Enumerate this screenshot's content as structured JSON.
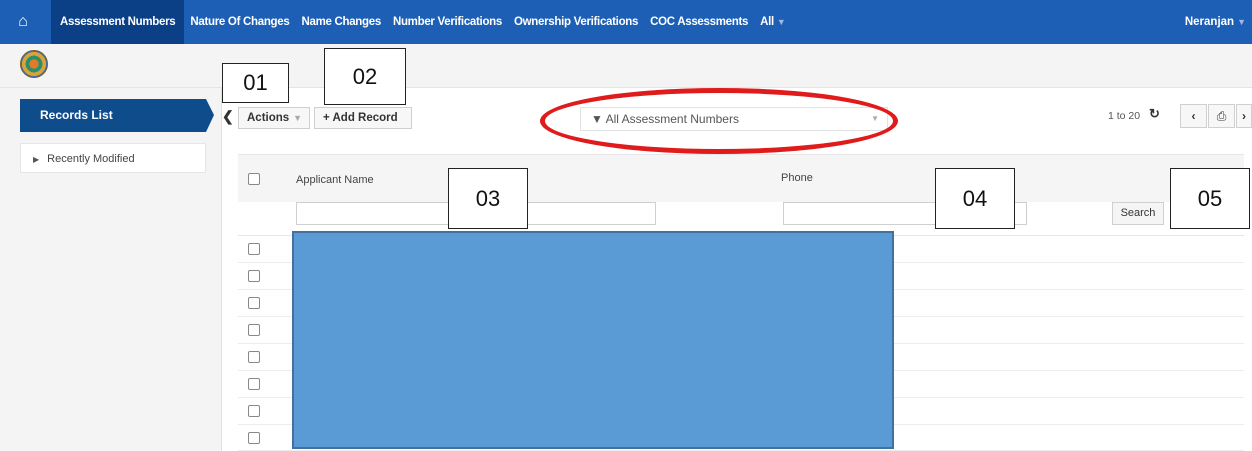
{
  "navbar": {
    "home_icon": "home-icon",
    "items": [
      {
        "label": "Assessment Numbers",
        "active": true
      },
      {
        "label": "Nature Of Changes"
      },
      {
        "label": "Name Changes"
      },
      {
        "label": "Number Verifications"
      },
      {
        "label": "Ownership Verifications"
      },
      {
        "label": "COC Assessments"
      },
      {
        "label": "All",
        "dropdown": true
      }
    ],
    "user": "Neranjan",
    "color": "#1d5fb4"
  },
  "sidebar": {
    "records_list": "Records List",
    "recently_modified": "Recently Modified"
  },
  "toolbar": {
    "actions_label": "Actions",
    "add_record_label": "+ Add Record",
    "filter_label": "All Assessment Numbers",
    "pager_text": "1 to 20"
  },
  "callouts": [
    "01",
    "02",
    "03",
    "04",
    "05"
  ],
  "table": {
    "columns": [
      "Applicant Name",
      "Phone"
    ],
    "search_label": "Search",
    "row_count": 8
  },
  "annotation_color": "#e01b1b",
  "redaction_color": "#5b9bd5"
}
